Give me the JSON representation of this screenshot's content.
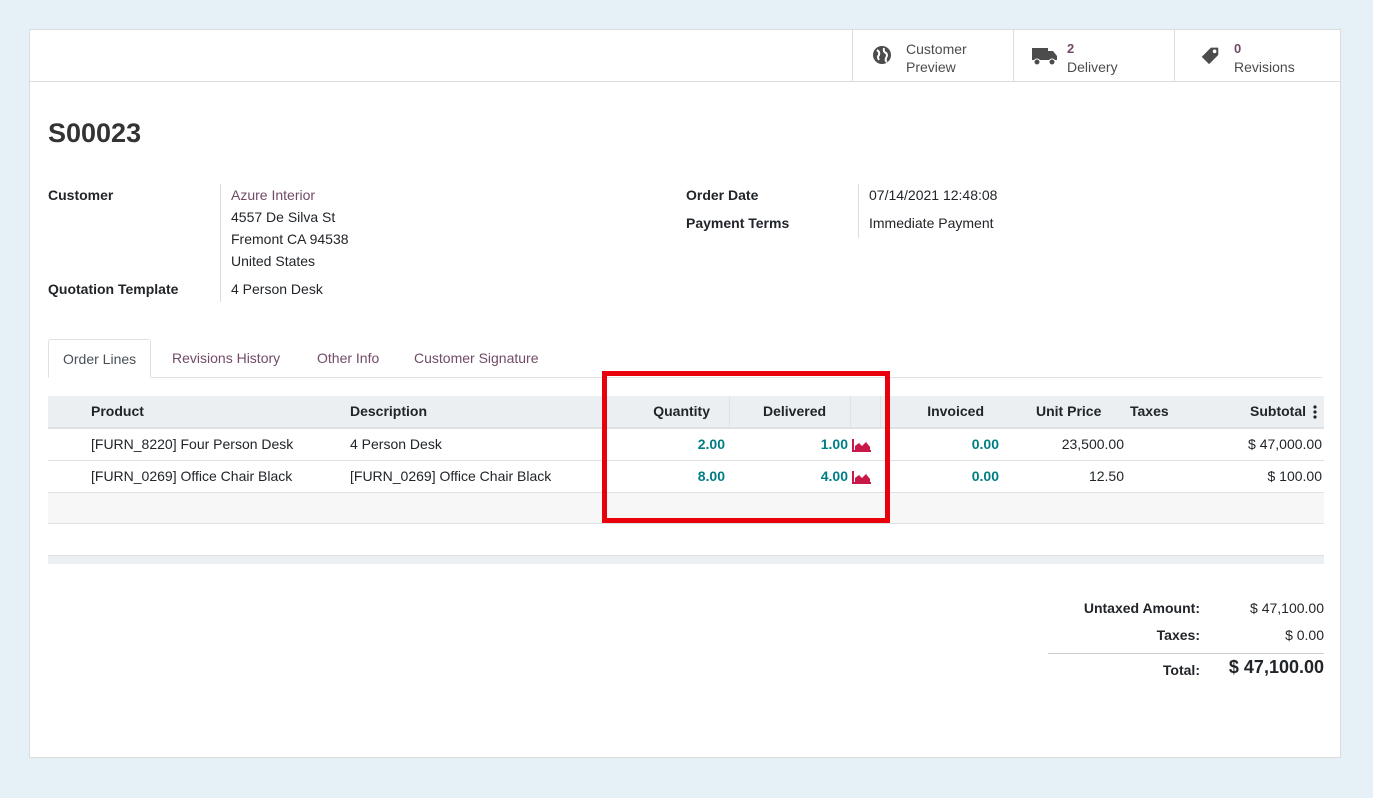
{
  "smart_buttons": [
    {
      "line1": "Customer",
      "line2": "Preview",
      "icon": "globe-icon"
    },
    {
      "count": "2",
      "line2": "Delivery",
      "icon": "truck-icon"
    },
    {
      "count": "0",
      "line2": "Revisions",
      "icon": "tags-icon"
    }
  ],
  "order": {
    "name": "S00023",
    "customer_label": "Customer",
    "customer_name": "Azure Interior",
    "address": [
      "4557 De Silva St",
      "Fremont CA 94538",
      "United States"
    ],
    "template_label": "Quotation Template",
    "template_value": "4 Person Desk",
    "order_date_label": "Order Date",
    "order_date_value": "07/14/2021 12:48:08",
    "payment_terms_label": "Payment Terms",
    "payment_terms_value": "Immediate Payment"
  },
  "tabs": [
    "Order Lines",
    "Revisions History",
    "Other Info",
    "Customer Signature"
  ],
  "table": {
    "headers": {
      "product": "Product",
      "description": "Description",
      "quantity": "Quantity",
      "delivered": "Delivered",
      "invoiced": "Invoiced",
      "unit_price": "Unit Price",
      "taxes": "Taxes",
      "subtotal": "Subtotal"
    },
    "rows": [
      {
        "product": "[FURN_8220] Four Person Desk",
        "description": "4 Person Desk",
        "quantity": "2.00",
        "delivered": "1.00",
        "invoiced": "0.00",
        "unit_price": "23,500.00",
        "taxes": "",
        "subtotal": "$ 47,000.00"
      },
      {
        "product": "[FURN_0269] Office Chair Black",
        "description": "[FURN_0269] Office Chair Black",
        "quantity": "8.00",
        "delivered": "4.00",
        "invoiced": "0.00",
        "unit_price": "12.50",
        "taxes": "",
        "subtotal": "$ 100.00"
      }
    ]
  },
  "totals": {
    "untaxed_label": "Untaxed Amount:",
    "untaxed_value": "$ 47,100.00",
    "taxes_label": "Taxes:",
    "taxes_value": "$ 0.00",
    "total_label": "Total:",
    "total_value": "$ 47,100.00"
  },
  "colors": {
    "accent": "#714b67",
    "teal": "#017e84",
    "highlight": "#e8000b",
    "forecast_icon": "#c9184a"
  }
}
